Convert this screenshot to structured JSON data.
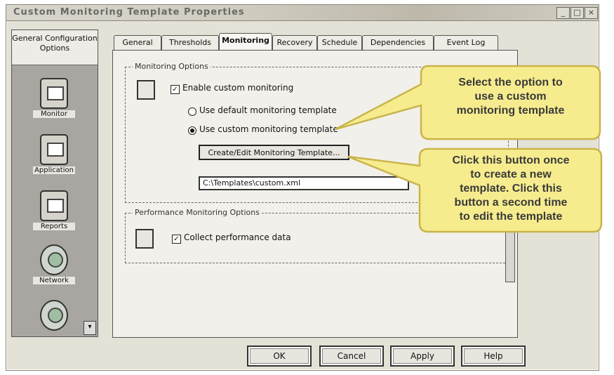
{
  "window": {
    "title": "Custom Monitoring Template Properties"
  },
  "left_pane": {
    "header": "General Configuration Options",
    "items": [
      {
        "label": "Monitor",
        "icon": "monitor-icon"
      },
      {
        "label": "Application",
        "icon": "application-icon"
      },
      {
        "label": "Reports",
        "icon": "reports-icon"
      },
      {
        "label": "Network",
        "icon": "network-icon"
      },
      {
        "label": "",
        "icon": "globe-icon"
      }
    ]
  },
  "tabs": [
    "General",
    "Thresholds",
    "Monitoring",
    "Recovery",
    "Schedule",
    "Dependencies",
    "Event Log"
  ],
  "active_tab": "Monitoring",
  "monitoring_group": {
    "title": "Monitoring Options",
    "enable_label": "Enable custom monitoring",
    "radio_default": "Use default monitoring template",
    "radio_custom": "Use custom monitoring template",
    "edit_button": "Create/Edit Monitoring Template...",
    "path_value": "C:\\Templates\\custom.xml"
  },
  "performance_group": {
    "title": "Performance Monitoring Options",
    "checkbox_label": "Collect performance data"
  },
  "buttons": {
    "ok": "OK",
    "cancel": "Cancel",
    "apply": "Apply",
    "help": "Help"
  },
  "callouts": {
    "first": [
      "Select the option to",
      "use a custom",
      "monitoring template"
    ],
    "second": [
      "Click this button once",
      "to create a new",
      "template. Click this",
      "button a second time",
      "to edit the template"
    ]
  },
  "colors": {
    "callout_fill": "#f6ec8e",
    "callout_border": "#c9b44a"
  }
}
